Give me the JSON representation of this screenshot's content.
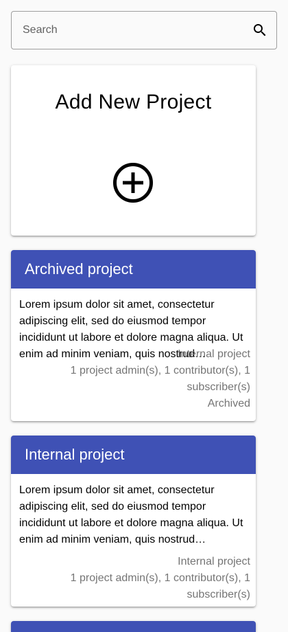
{
  "search": {
    "placeholder": "Search",
    "icon": "search-icon"
  },
  "add_project": {
    "title": "Add New Project",
    "icon": "plus-circle-icon"
  },
  "projects": [
    {
      "title": "Archived project",
      "description": "Lorem ipsum dolor sit amet, consectetur adipiscing elit, sed do eiusmod tempor incididunt ut labore et dolore magna aliqua. Ut enim ad minim veniam, quis nostrud…",
      "visibility": "Internal project",
      "members": "1 project admin(s), 1 contributor(s), 1 subscriber(s)",
      "status": "Archived"
    },
    {
      "title": "Internal project",
      "description": "Lorem ipsum dolor sit amet, consectetur adipiscing elit, sed do eiusmod tempor incididunt ut labore et dolore magna aliqua. Ut enim ad minim veniam, quis nostrud…",
      "visibility": "Internal project",
      "members": "1 project admin(s), 1 contributor(s), 1 subscriber(s)"
    }
  ],
  "colors": {
    "header": "#3f51b5",
    "header_text": "#ffffff",
    "meta_text": "#757575"
  }
}
